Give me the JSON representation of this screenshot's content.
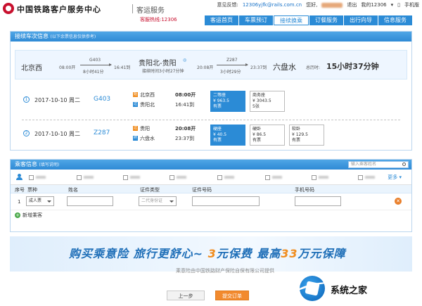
{
  "header": {
    "logo_title": "中国铁路客户服务中心",
    "logo_sub": "客运服务",
    "hotline": "客服热线:12306",
    "feedback_label": "意见反馈:",
    "feedback_email": "12306yjfk@rails.com.cn",
    "greeting": "您好,",
    "logout": "退出",
    "my12306": "我的12306",
    "mobile": "手机版"
  },
  "nav": [
    {
      "label": "客运首页",
      "active": false
    },
    {
      "label": "车票预订",
      "active": false
    },
    {
      "label": "接续换乘",
      "active": true
    },
    {
      "label": "订餐服务",
      "active": false
    },
    {
      "label": "出行向导",
      "active": false
    },
    {
      "label": "信息服务",
      "active": false
    }
  ],
  "transfer": {
    "title": "接续车次信息",
    "hint": "(以下余票信息仅供参考)",
    "summary": {
      "from": "北京西",
      "dep_time": "08:00开",
      "train1": "G403",
      "dur1": "8小时41分",
      "arr1": "16:41到",
      "transfer_station": "贵阳北-贵阳",
      "transfer_note": "接续时间3小时27分钟",
      "dep2": "20:08开",
      "train2": "Z287",
      "dur2": "3小时29分",
      "arr2": "23:37到",
      "to": "六盘水",
      "total_label": "总历时:",
      "total": "15小时37分钟"
    },
    "rows": [
      {
        "index": "1",
        "date": "2017-10-10 周二",
        "train": "G403",
        "from_station": "北京西",
        "from_time": "08:00开",
        "to_station": "贵阳北",
        "to_time": "16:41到",
        "seats": [
          {
            "name": "二等座",
            "price": "¥ 963.5",
            "avail": "有票",
            "selected": true
          },
          {
            "name": "商务座",
            "price": "¥ 3043.5",
            "avail": "5张",
            "selected": false
          }
        ]
      },
      {
        "index": "2",
        "date": "2017-10-10 周二",
        "train": "Z287",
        "from_station": "贵阳",
        "from_time": "20:08开",
        "to_station": "六盘水",
        "to_time": "23:37到",
        "seats": [
          {
            "name": "硬座",
            "price": "¥ 40.5",
            "avail": "有票",
            "selected": true
          },
          {
            "name": "硬卧",
            "price": "¥ 86.5",
            "avail": "有票",
            "selected": false
          },
          {
            "name": "软卧",
            "price": "¥ 129.5",
            "avail": "有票",
            "selected": false
          }
        ]
      }
    ]
  },
  "passenger": {
    "title": "乘客信息",
    "hint": "(填写说明)",
    "search_placeholder": "输入乘客姓名",
    "more": "更多",
    "columns": [
      "序号",
      "票种",
      "姓名",
      "证件类型",
      "证件号码",
      "手机号码"
    ],
    "row": {
      "index": "1",
      "ticket_type": "成人票",
      "id_type": "二代身份证"
    },
    "add_label": "新增乘客"
  },
  "banner": {
    "part1": "购买乘意险  旅行更舒心~  ",
    "part2": "3",
    "part3": "元保费  最高",
    "part4": "33",
    "part5": "万元保障",
    "sub": "乘意险由中国铁路财产保险自保有限公司提供"
  },
  "buttons": {
    "prev": "上一步",
    "submit": "提交订单"
  },
  "watermark": {
    "text": "系统之家"
  },
  "colors": {
    "primary": "#2b8bd6",
    "accent": "#f28a2e",
    "brand_red": "#c8102e"
  }
}
